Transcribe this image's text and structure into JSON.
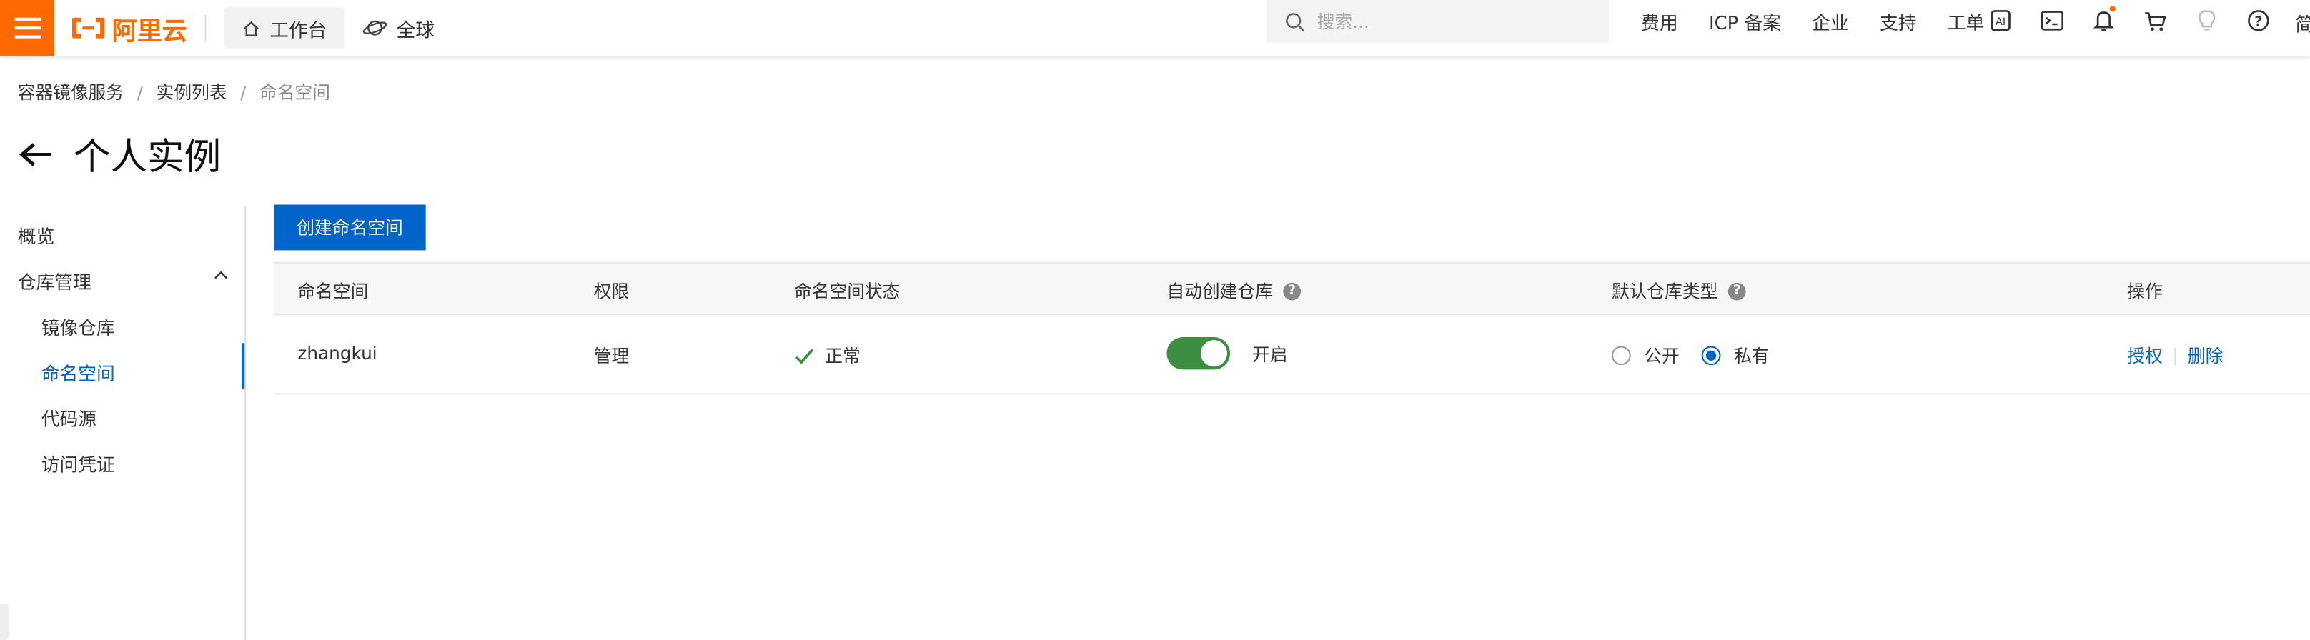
{
  "topbar": {
    "logo_text": "阿里云",
    "workbench_label": "工作台",
    "region_label": "全球",
    "search_placeholder": "搜索...",
    "links": [
      "费用",
      "ICP 备案",
      "企业",
      "支持",
      "工单"
    ],
    "lang_label": "简"
  },
  "breadcrumb": {
    "items": [
      "容器镜像服务",
      "实例列表",
      "命名空间"
    ]
  },
  "page": {
    "title": "个人实例"
  },
  "sidebar": {
    "overview": "概览",
    "repo_manage": "仓库管理",
    "children": [
      "镜像仓库",
      "命名空间",
      "代码源",
      "访问凭证"
    ],
    "active": "命名空间"
  },
  "main": {
    "create_button": "创建命名空间",
    "columns": [
      "命名空间",
      "权限",
      "命名空间状态",
      "自动创建仓库",
      "默认仓库类型",
      "操作"
    ],
    "rows": [
      {
        "namespace": "zhangkui",
        "permission": "管理",
        "status": "正常",
        "auto_create": true,
        "auto_create_label": "开启",
        "repo_type_options": [
          "公开",
          "私有"
        ],
        "repo_type_selected": "私有",
        "actions": [
          "授权",
          "删除"
        ]
      }
    ]
  },
  "colors": {
    "brand": "#ff6a00",
    "primary": "#0064c8",
    "switch_on": "#3e8e41",
    "status_ok": "#3e8e41"
  }
}
